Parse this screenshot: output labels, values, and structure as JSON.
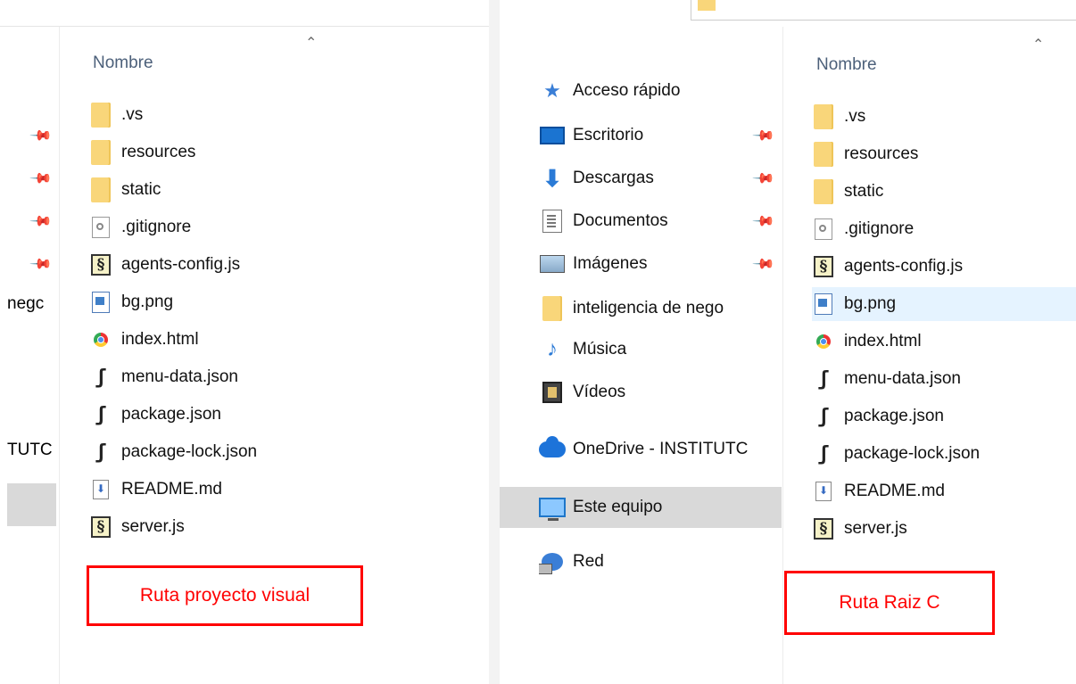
{
  "left": {
    "column_header": "Nombre",
    "sort_icon": "chevron-up-icon",
    "cut_nav_labels": [
      "negc",
      "TUTC"
    ],
    "files": [
      {
        "name": ".vs",
        "icon": "folder-icon"
      },
      {
        "name": "resources",
        "icon": "folder-icon"
      },
      {
        "name": "static",
        "icon": "folder-icon"
      },
      {
        "name": ".gitignore",
        "icon": "settings-file-icon"
      },
      {
        "name": "agents-config.js",
        "icon": "js-file-icon"
      },
      {
        "name": "bg.png",
        "icon": "image-file-icon"
      },
      {
        "name": "index.html",
        "icon": "chrome-html-icon"
      },
      {
        "name": "menu-data.json",
        "icon": "json-file-icon"
      },
      {
        "name": "package.json",
        "icon": "json-file-icon"
      },
      {
        "name": "package-lock.json",
        "icon": "json-file-icon"
      },
      {
        "name": "README.md",
        "icon": "markdown-file-icon"
      },
      {
        "name": "server.js",
        "icon": "js-file-icon"
      }
    ],
    "annotation": "Ruta proyecto visual"
  },
  "right": {
    "column_header": "Nombre",
    "sort_icon": "chevron-up-icon",
    "nav": [
      {
        "label": "Acceso rápido",
        "icon": "star-icon",
        "pinned": false
      },
      {
        "label": "Escritorio",
        "icon": "desktop-icon",
        "pinned": true
      },
      {
        "label": "Descargas",
        "icon": "download-icon",
        "pinned": true
      },
      {
        "label": "Documentos",
        "icon": "documents-icon",
        "pinned": true
      },
      {
        "label": "Imágenes",
        "icon": "pictures-icon",
        "pinned": true
      },
      {
        "label": "inteligencia de nego",
        "icon": "folder-icon",
        "pinned": false
      },
      {
        "label": "Música",
        "icon": "music-icon",
        "pinned": false
      },
      {
        "label": "Vídeos",
        "icon": "videos-icon",
        "pinned": false
      },
      {
        "label": "OneDrive - INSTITUTC",
        "icon": "onedrive-cloud-icon",
        "pinned": false
      },
      {
        "label": "Este equipo",
        "icon": "this-pc-icon",
        "pinned": false,
        "selected": true
      },
      {
        "label": "Red",
        "icon": "network-icon",
        "pinned": false
      }
    ],
    "files": [
      {
        "name": ".vs",
        "icon": "folder-icon"
      },
      {
        "name": "resources",
        "icon": "folder-icon"
      },
      {
        "name": "static",
        "icon": "folder-icon"
      },
      {
        "name": ".gitignore",
        "icon": "settings-file-icon"
      },
      {
        "name": "agents-config.js",
        "icon": "js-file-icon"
      },
      {
        "name": "bg.png",
        "icon": "image-file-icon",
        "hovered": true
      },
      {
        "name": "index.html",
        "icon": "chrome-html-icon"
      },
      {
        "name": "menu-data.json",
        "icon": "json-file-icon"
      },
      {
        "name": "package.json",
        "icon": "json-file-icon"
      },
      {
        "name": "package-lock.json",
        "icon": "json-file-icon"
      },
      {
        "name": "README.md",
        "icon": "markdown-file-icon"
      },
      {
        "name": "server.js",
        "icon": "js-file-icon"
      }
    ],
    "annotation": "Ruta Raiz C"
  },
  "colors": {
    "annotation_red": "#ff0000",
    "header_text": "#4c607a",
    "hover_row": "#e5f3ff",
    "selected_nav": "#d9d9d9"
  }
}
